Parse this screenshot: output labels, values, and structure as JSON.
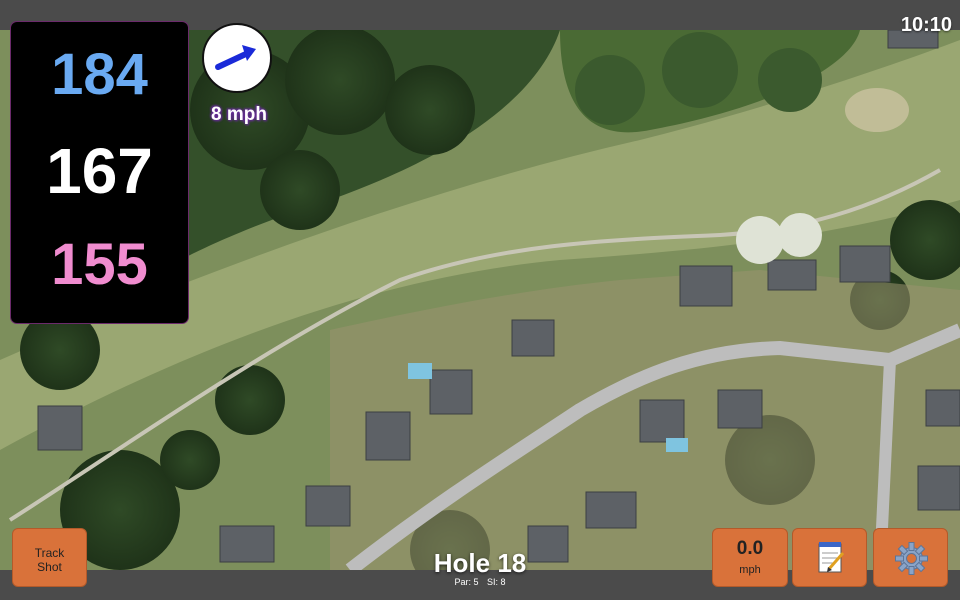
{
  "status": {
    "time": "10:10"
  },
  "distances": {
    "back": "184",
    "center": "167",
    "front": "155"
  },
  "wind": {
    "speed": "8 mph",
    "direction": "arrow-right-icon"
  },
  "hole": {
    "title": "Hole 18",
    "par": "Par: 5",
    "si": "SI: 8"
  },
  "buttons": {
    "track_shot": "Track\nShot",
    "track_line1": "Track",
    "track_line2": "Shot",
    "speed_value": "0.0",
    "speed_unit": "mph",
    "notes_icon": "notepad-icon",
    "settings_icon": "gear-icon"
  },
  "colors": {
    "back_distance": "#6aaaf2",
    "center_distance": "#ffffff",
    "front_distance": "#f08ccf",
    "button": "#d9723a",
    "wind_arrow": "#1a2ad8"
  }
}
